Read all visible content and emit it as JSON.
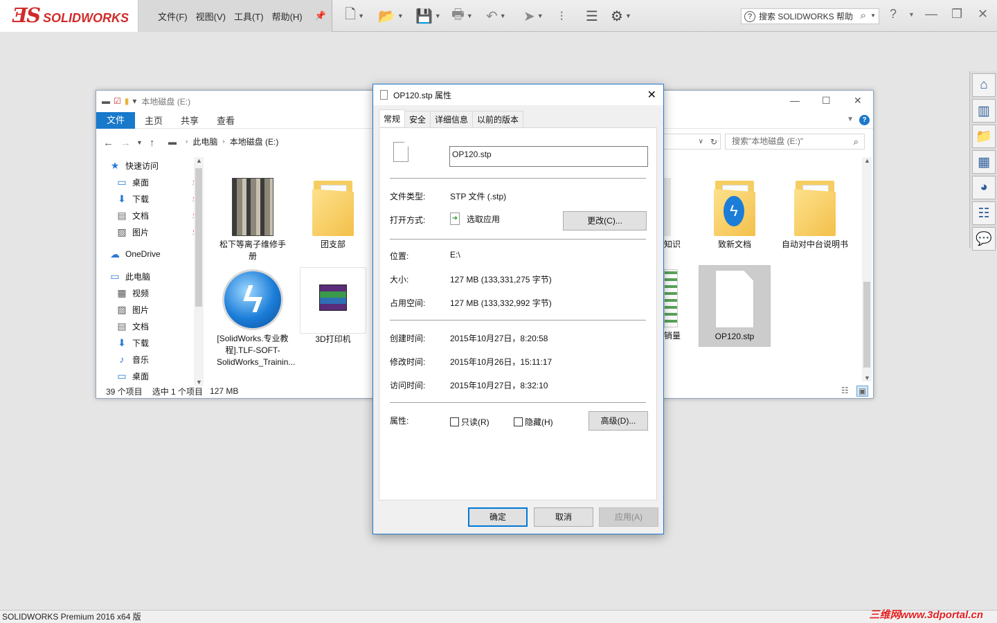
{
  "app": {
    "logo_text": "SOLIDWORKS",
    "menu": [
      "文件(F)",
      "视图(V)",
      "工具(T)",
      "帮助(H)"
    ],
    "search_placeholder": "搜索 SOLIDWORKS 帮助",
    "status_bar": "SOLIDWORKS Premium 2016 x64 版",
    "watermark": "三维网www.3dportal.cn",
    "toolbar_icons": [
      "new-document-icon",
      "open-icon",
      "save-icon",
      "print-icon",
      "undo-icon",
      "select-icon",
      "traffic-light-icon",
      "options-list-icon",
      "gear-icon"
    ],
    "task_pane_icons": [
      "home-icon",
      "design-library-icon",
      "file-explorer-icon",
      "view-palette-icon",
      "appearance-icon",
      "custom-properties-icon",
      "forum-icon"
    ]
  },
  "explorer": {
    "title": "本地磁盘 (E:)",
    "ribbon": {
      "file": "文件",
      "tabs": [
        "主页",
        "共享",
        "查看"
      ]
    },
    "breadcrumb": [
      "此电脑",
      "本地磁盘 (E:)"
    ],
    "search_placeholder": "搜索\"本地磁盘 (E:)\"",
    "sidebar": [
      {
        "label": "快速访问",
        "icon": "star-icon",
        "level": 0
      },
      {
        "label": "桌面",
        "icon": "desktop-icon",
        "level": 1,
        "pinned": true
      },
      {
        "label": "下载",
        "icon": "download-icon",
        "level": 1,
        "pinned": true
      },
      {
        "label": "文档",
        "icon": "document-icon",
        "level": 1,
        "pinned": true
      },
      {
        "label": "图片",
        "icon": "pictures-icon",
        "level": 1,
        "pinned": true
      },
      {
        "label": "OneDrive",
        "icon": "cloud-icon",
        "level": 0
      },
      {
        "label": "此电脑",
        "icon": "computer-icon",
        "level": 0
      },
      {
        "label": "视频",
        "icon": "video-icon",
        "level": 1
      },
      {
        "label": "图片",
        "icon": "pictures-icon",
        "level": 1
      },
      {
        "label": "文档",
        "icon": "document-icon",
        "level": 1
      },
      {
        "label": "下载",
        "icon": "download-icon",
        "level": 1
      },
      {
        "label": "音乐",
        "icon": "music-icon",
        "level": 1
      },
      {
        "label": "桌面",
        "icon": "desktop-icon",
        "level": 1
      }
    ],
    "files_left": [
      {
        "name": "松下等离子维修手册",
        "type": "image-stack"
      },
      {
        "name": "团支部",
        "type": "folder"
      },
      {
        "name": "[SolidWorks.专业教程].TLF-SOFT-SolidWorks_Trainin...",
        "type": "daemon"
      },
      {
        "name": "3D打印机",
        "type": "rar"
      }
    ],
    "files_right": [
      {
        "name": "知识",
        "type": "partial"
      },
      {
        "name": "致新文档",
        "type": "folder"
      },
      {
        "name": "自动对中台说明书",
        "type": "folder"
      },
      {
        "name": "销量",
        "type": "partial"
      },
      {
        "name": "OP120.stp",
        "type": "file",
        "selected": true
      }
    ],
    "status": {
      "count": "39 个项目",
      "selected": "选中 1 个项目",
      "size": "127 MB"
    }
  },
  "dialog": {
    "title": "OP120.stp 属性",
    "tabs": [
      "常规",
      "安全",
      "详细信息",
      "以前的版本"
    ],
    "filename": "OP120.stp",
    "file_type_label": "文件类型:",
    "file_type": "STP 文件 (.stp)",
    "open_with_label": "打开方式:",
    "open_with": "选取应用",
    "change_button": "更改(C)...",
    "location_label": "位置:",
    "location": "E:\\",
    "size_label": "大小:",
    "size": "127 MB (133,331,275 字节)",
    "size_on_disk_label": "占用空间:",
    "size_on_disk": "127 MB (133,332,992 字节)",
    "created_label": "创建时间:",
    "created": "2015年10月27日，8:20:58",
    "modified_label": "修改时间:",
    "modified": "2015年10月26日，15:11:17",
    "accessed_label": "访问时间:",
    "accessed": "2015年10月27日，8:32:10",
    "attributes_label": "属性:",
    "readonly": "只读(R)",
    "hidden": "隐藏(H)",
    "advanced_button": "高级(D)...",
    "ok": "确定",
    "cancel": "取消",
    "apply": "应用(A)"
  }
}
